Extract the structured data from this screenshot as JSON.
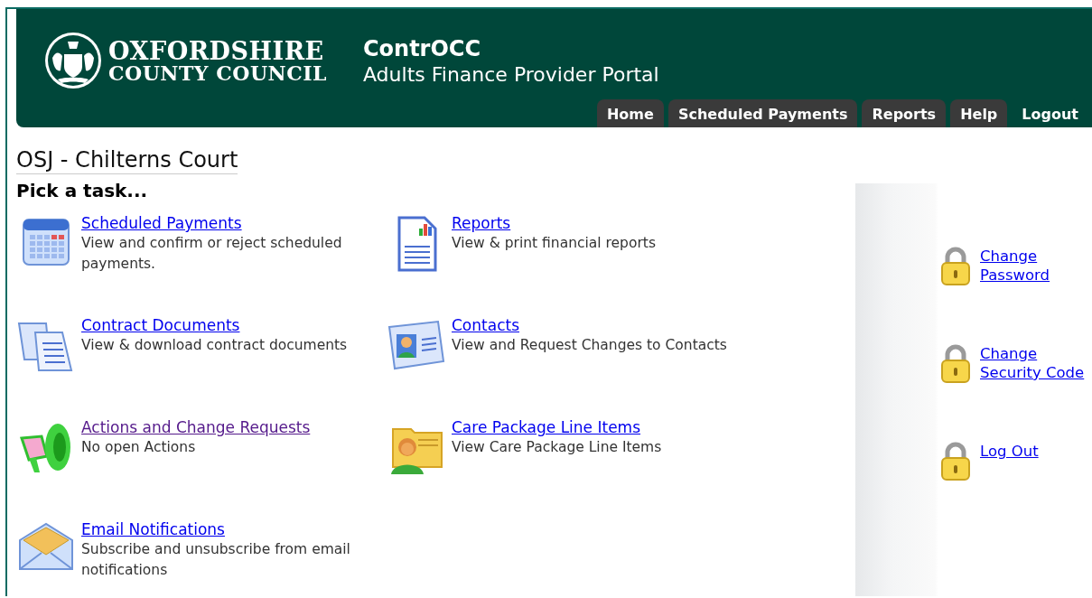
{
  "header": {
    "logo": {
      "line_1": "OXFORDSHIRE",
      "line_2": "COUNTY COUNCIL"
    },
    "app_name": "ContrOCC",
    "subtitle": "Adults Finance Provider Portal"
  },
  "nav": [
    {
      "label": "Home",
      "kind": "tab"
    },
    {
      "label": "Scheduled Payments",
      "kind": "tab"
    },
    {
      "label": "Reports",
      "kind": "tab"
    },
    {
      "label": "Help",
      "kind": "tab"
    },
    {
      "label": "Logout",
      "kind": "plain"
    }
  ],
  "page_title": "OSJ - Chilterns Court",
  "heading": "Pick a task...",
  "tasks": [
    {
      "title": "Scheduled Payments",
      "description": "View and confirm or reject scheduled payments.",
      "visited": false
    },
    {
      "title": "Reports",
      "description": "View & print financial reports",
      "visited": false
    },
    {
      "title": "Contract Documents",
      "description": "View & download contract documents",
      "visited": false
    },
    {
      "title": "Contacts",
      "description": "View and Request Changes to Contacts",
      "visited": false
    },
    {
      "title": "Actions and Change Requests",
      "description": "No open Actions",
      "visited": true
    },
    {
      "title": "Care Package Line Items",
      "description": "View Care Package Line Items",
      "visited": false
    },
    {
      "title": "Email Notifications",
      "description": "Subscribe and unsubscribe from email notifications",
      "visited": false
    }
  ],
  "account_links": [
    {
      "label": "Change Password"
    },
    {
      "label": "Change Security Code"
    },
    {
      "label": "Log Out"
    }
  ]
}
